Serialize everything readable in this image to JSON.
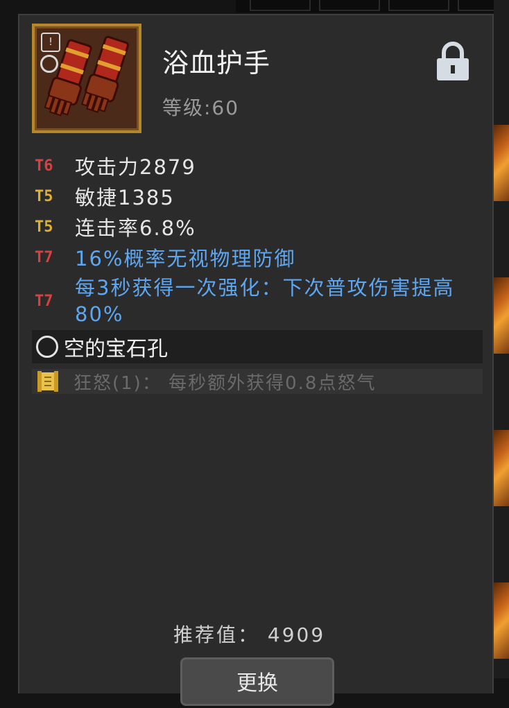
{
  "item": {
    "name": "浴血护手",
    "level": "等级:60",
    "badge": "!"
  },
  "stats": [
    {
      "tier": "T6",
      "text": "攻击力2879"
    },
    {
      "tier": "T5",
      "text": "敏捷1385"
    },
    {
      "tier": "T5",
      "text": "连击率6.8%"
    },
    {
      "tier": "T7",
      "text": "16%概率无视物理防御"
    },
    {
      "tier": "T7",
      "text": "每3秒获得一次强化：下次普攻伤害提高80%"
    }
  ],
  "gem_socket": {
    "label": "空的宝石孔"
  },
  "passive": {
    "text": "狂怒(1)： 每秒额外获得0.8点怒气"
  },
  "recommend": {
    "text": "推荐值： 4909"
  },
  "action_button": {
    "label": "更换"
  },
  "colors": {
    "tier_red": "#d94040",
    "tier_gold": "#e0b030",
    "special_text": "#5ea6ef",
    "frame_gold": "#b5862a"
  },
  "icons": [
    "gauntlet-icon",
    "lock-icon",
    "socket-icon",
    "scroll-icon"
  ]
}
